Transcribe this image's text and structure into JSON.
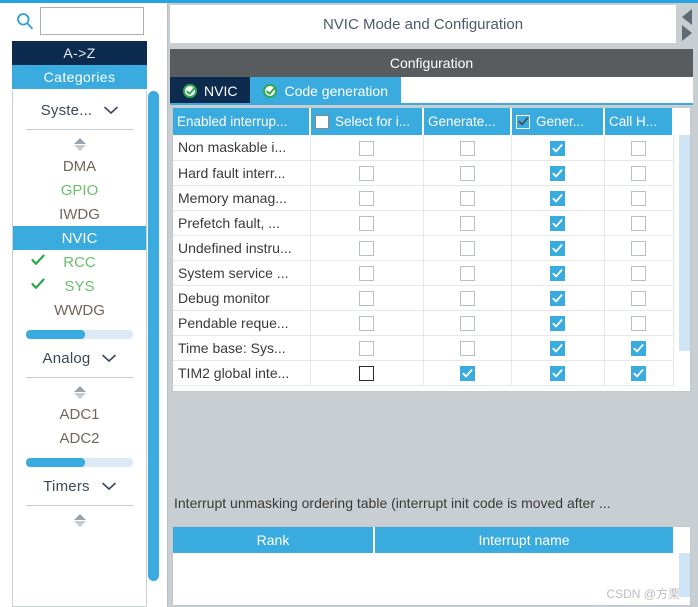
{
  "sidebar": {
    "search": {
      "value": "",
      "placeholder": "",
      "icon": "search-icon"
    },
    "mode_buttons": {
      "az": "A->Z",
      "categories": "Categories"
    },
    "groups": [
      {
        "title": "Syste...",
        "chevron": "⌵",
        "items": [
          {
            "label": "DMA",
            "state": "normal",
            "check": ""
          },
          {
            "label": "GPIO",
            "state": "ok",
            "check": ""
          },
          {
            "label": "IWDG",
            "state": "normal",
            "check": ""
          },
          {
            "label": "NVIC",
            "state": "selected",
            "check": ""
          },
          {
            "label": "RCC",
            "state": "ok",
            "check": "✔"
          },
          {
            "label": "SYS",
            "state": "ok",
            "check": "✔"
          },
          {
            "label": "WWDG",
            "state": "normal",
            "check": ""
          }
        ],
        "scroll_pct": 55
      },
      {
        "title": "Analog",
        "chevron": "⌵",
        "items": [
          {
            "label": "ADC1",
            "state": "normal",
            "check": ""
          },
          {
            "label": "ADC2",
            "state": "normal",
            "check": ""
          }
        ],
        "scroll_pct": 55
      },
      {
        "title": "Timers",
        "chevron": "⌵",
        "items": [],
        "scroll_pct": 0
      }
    ]
  },
  "main": {
    "title": "NVIC Mode and Configuration",
    "nav": {
      "prev_icon": "triangle-left-icon",
      "next_icon": "triangle-right-icon"
    },
    "config_band": "Configuration",
    "tabs": [
      {
        "label": "NVIC",
        "active": true,
        "icon": "check-circle-icon"
      },
      {
        "label": "Code generation",
        "active": false,
        "icon": "check-circle-icon"
      }
    ],
    "table": {
      "columns": [
        {
          "label": "Enabled interrup...",
          "checkbox": null
        },
        {
          "label": "Select for i...",
          "checkbox": "unchecked"
        },
        {
          "label": "Generate...",
          "checkbox": null
        },
        {
          "label": "Gener...",
          "checkbox": "checked"
        },
        {
          "label": "Call H...",
          "checkbox": null
        }
      ],
      "rows": [
        {
          "name": "Non maskable i...",
          "select": "off",
          "gen_ieh": "off",
          "gen_code": "on",
          "call_handler": "off"
        },
        {
          "name": "Hard fault interr...",
          "select": "off",
          "gen_ieh": "off",
          "gen_code": "on",
          "call_handler": "off"
        },
        {
          "name": "Memory manag...",
          "select": "off",
          "gen_ieh": "off",
          "gen_code": "on",
          "call_handler": "off"
        },
        {
          "name": "Prefetch fault, ...",
          "select": "off",
          "gen_ieh": "off",
          "gen_code": "on",
          "call_handler": "off"
        },
        {
          "name": "Undefined instru...",
          "select": "off",
          "gen_ieh": "off",
          "gen_code": "on",
          "call_handler": "off"
        },
        {
          "name": "System service ...",
          "select": "off",
          "gen_ieh": "off",
          "gen_code": "on",
          "call_handler": "off"
        },
        {
          "name": "Debug monitor",
          "select": "off",
          "gen_ieh": "off",
          "gen_code": "on",
          "call_handler": "off"
        },
        {
          "name": "Pendable reque...",
          "select": "off",
          "gen_ieh": "off",
          "gen_code": "on",
          "call_handler": "off"
        },
        {
          "name": "Time base: Sys...",
          "select": "off",
          "gen_ieh": "off",
          "gen_code": "on",
          "call_handler": "on"
        },
        {
          "name": "TIM2 global inte...",
          "select": "off-enabled",
          "gen_ieh": "on",
          "gen_code": "on",
          "call_handler": "on"
        }
      ]
    },
    "ordering": {
      "note": "Interrupt unmasking ordering table (interrupt init code is moved after ...",
      "columns": [
        "Rank",
        "Interrupt name"
      ],
      "rows": []
    }
  },
  "watermark": "CSDN @方栗"
}
